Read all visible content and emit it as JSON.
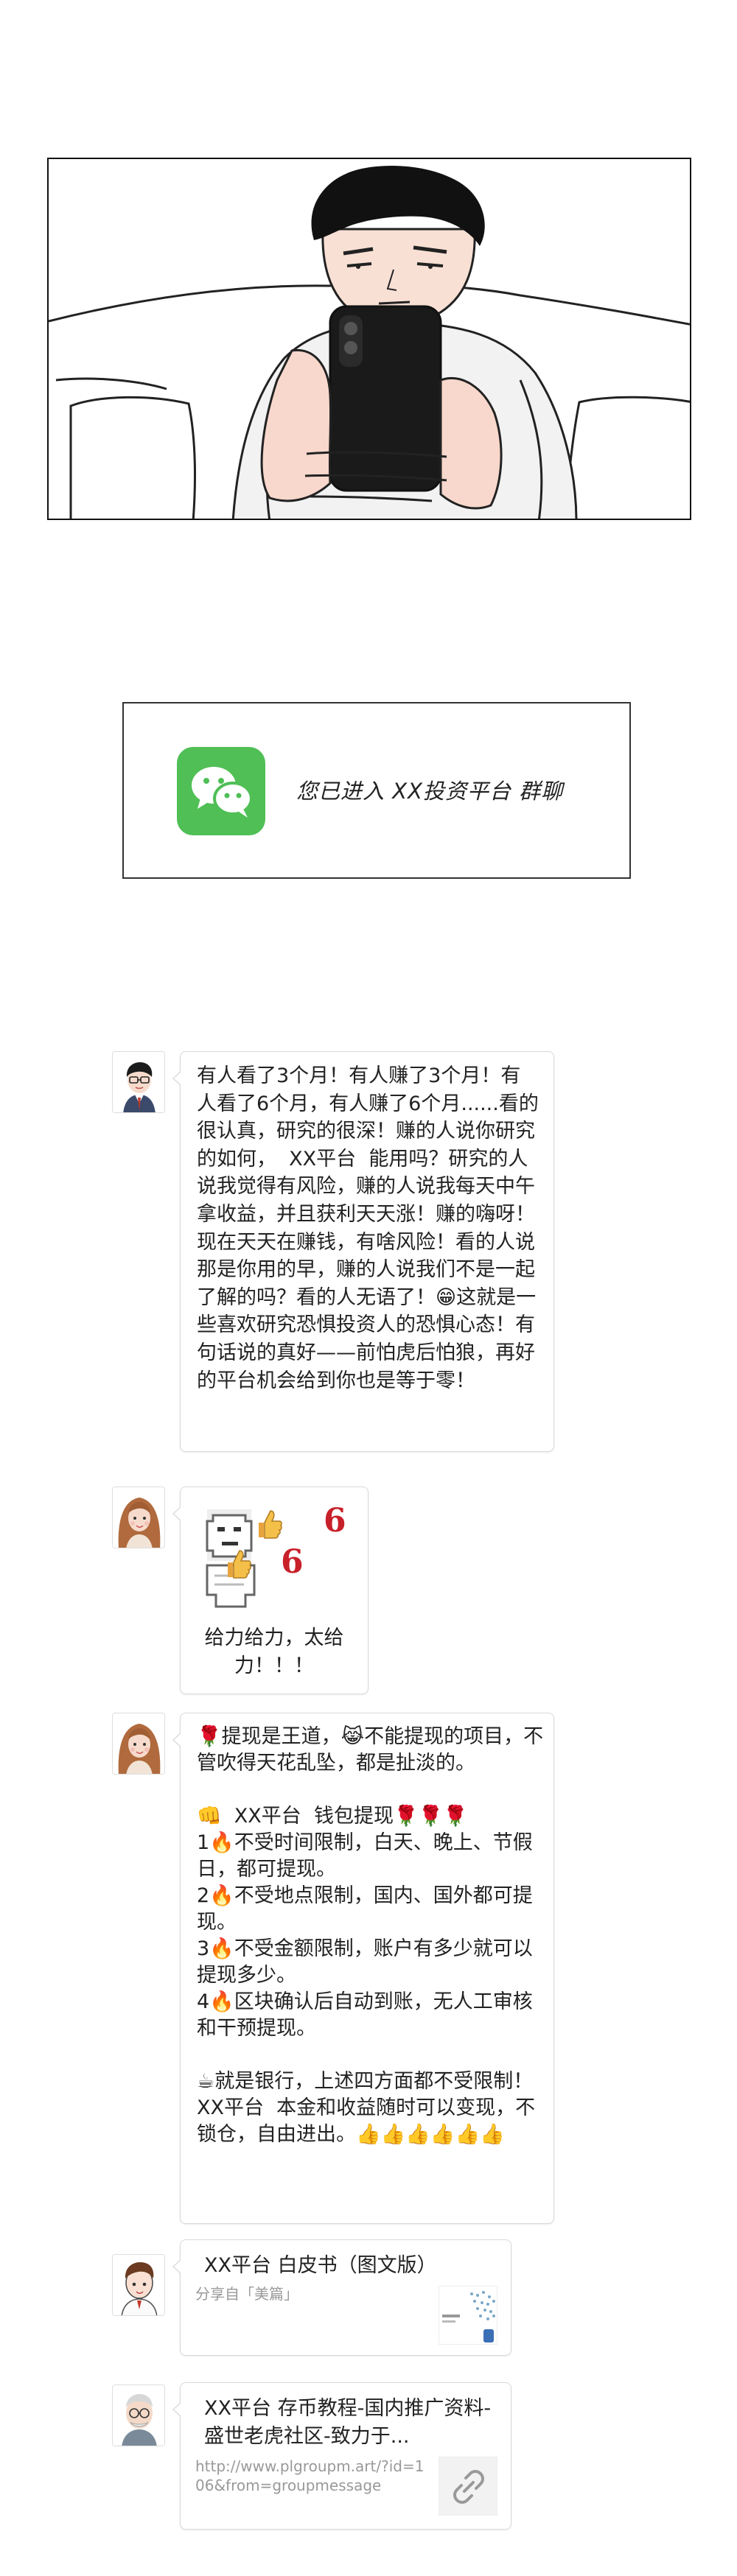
{
  "notice": {
    "text": "您已进入 XX投资平台 群聊",
    "accent": "#4fbf56"
  },
  "messages": [
    {
      "avatar": "man-glasses-avatar",
      "text": "有人看了3个月！有人赚了3个月！有人看了6个月，有人赚了6个月......看的很认真，研究的很深！赚的人说你研究的如何，  XX平台  能用吗？研究的人说我觉得有风险，赚的人说我每天中午拿收益，并且获利天天涨！赚的嗨呀！现在天天在赚钱，有啥风险！看的人说那是你用的早，赚的人说我们不是一起了解的吗？看的人无语了！😁这就是一些喜欢研究恐惧投资人的恐惧心态！有句话说的真好——前怕虎后怕狼，再好的平台机会给到你也是等于零！"
    },
    {
      "avatar": "woman-avatar",
      "sticker": "thumbs-up-sticker",
      "sticker_marks": [
        "6",
        "6"
      ],
      "caption": "给力给力，太给力！！！"
    },
    {
      "avatar": "woman-avatar",
      "text": "🌹提现是王道，😹不能提现的项目，不管吹得天花乱坠，都是扯淡的。\n\n👊  XX平台  钱包提现🌹🌹🌹\n1🔥不受时间限制，白天、晚上、节假日，都可提现。\n2🔥不受地点限制，国内、国外都可提现。\n3🔥不受金额限制，账户有多少就可以提现多少。\n4🔥区块确认后自动到账，无人工审核和干预提现。\n\n☕就是银行，上述四方面都不受限制！  XX平台  本金和收益随时可以变现，不锁仓，自由进出。👍👍👍👍👍👍"
    },
    {
      "avatar": "cartoon-man-avatar",
      "link_title": "XX平台  白皮书（图文版）",
      "link_source": "分享自「美篇」"
    },
    {
      "avatar": "old-man-avatar",
      "link_title": "XX平台  存币教程-国内推广资料-盛世老虎社区-致力于...",
      "link_url": "http://www.plgroupm.art/?id=106&from=groupmessage"
    }
  ]
}
